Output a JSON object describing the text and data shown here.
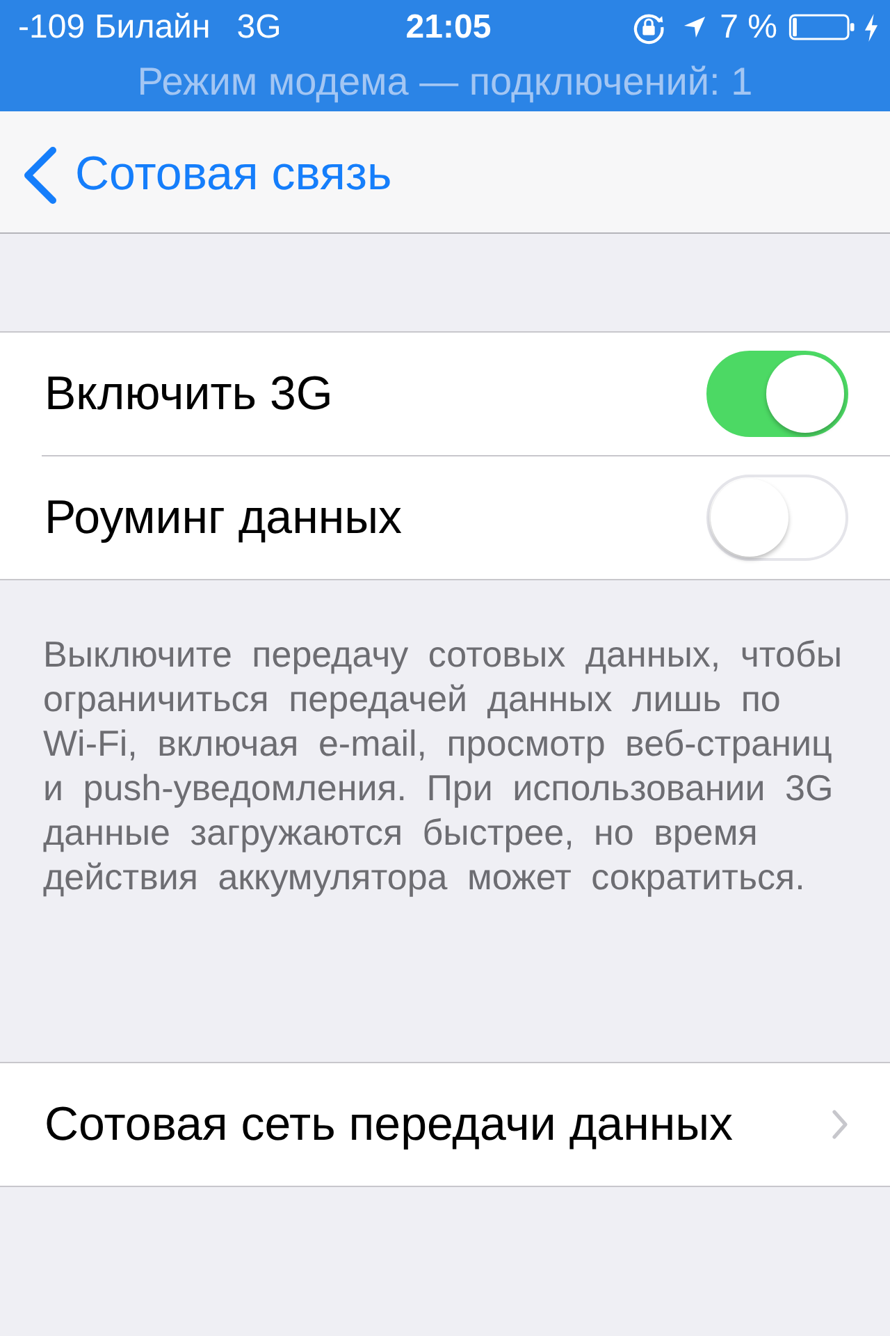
{
  "status_bar": {
    "signal": "-109",
    "carrier": "Билайн",
    "network": "3G",
    "time": "21:05",
    "battery_percent": "7 %",
    "charging": true
  },
  "hotspot_banner": "Режим модема — подключений: 1",
  "nav_bar": {
    "back_label": "Сотовая связь"
  },
  "settings": [
    {
      "label": "Включить 3G",
      "kind": "toggle",
      "on": true
    },
    {
      "label": "Роуминг данных",
      "kind": "toggle",
      "on": false
    }
  ],
  "footer_note": "Выключите передачу сотовых данных, чтобы ограничиться передачей данных лишь по Wi-Fi, включая e-mail, просмотр веб-страниц и push-уведомления. При использовании 3G данные загружаются быстрее, но время действия аккумулятора может сократиться.",
  "links": [
    {
      "label": "Сотовая сеть передачи данных",
      "kind": "disclosure"
    }
  ]
}
